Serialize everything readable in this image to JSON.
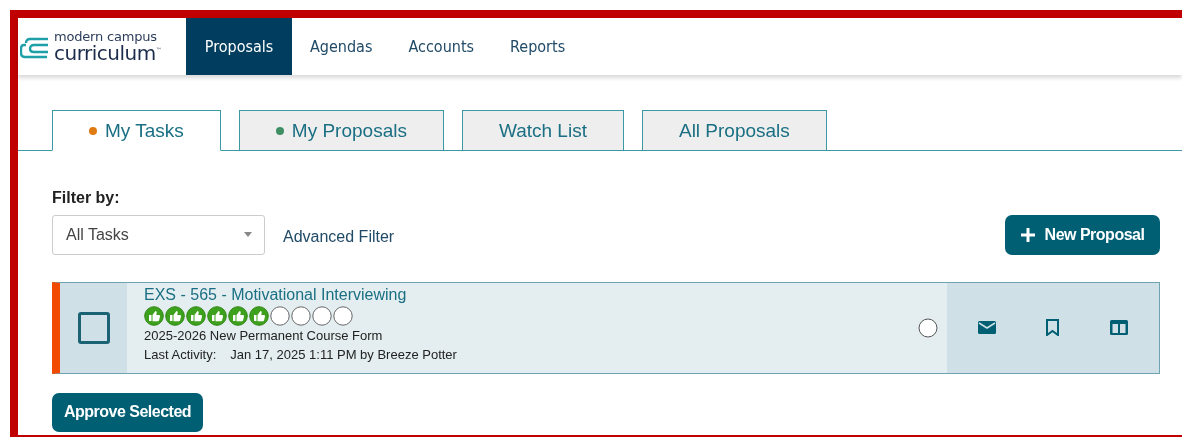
{
  "logo": {
    "line_1": "modern campus",
    "line_2": "curriculum$^{™}$"
  },
  "nav": [
    {
      "label": "Proposals",
      "selected": true
    },
    {
      "label": "Agendas",
      "selected": false
    },
    {
      "label": "Accounts",
      "selected": false
    },
    {
      "label": "Reports",
      "selected": false
    }
  ],
  "tabs": [
    {
      "label": "My Tasks",
      "selected": true,
      "color": "#e07b14"
    },
    {
      "label": "My Proposals",
      "selected": false,
      "color": "#3f8f64"
    },
    {
      "label": "Watch List",
      "selected": false
    },
    {
      "label": "All Proposals",
      "selected": false
    }
  ],
  "filter": {
    "label": "Filter by:",
    "value": "All Tasks",
    "advanced": "Advanced Filter"
  },
  "new_button": "New Proposal",
  "proposals": [
    {
      "title": "EXS - 565 - Motivational Interviewing",
      "checked": false,
      "steps": [
        {
          "done": true
        },
        {
          "done": true
        },
        {
          "done": true
        },
        {
          "done": true
        },
        {
          "done": true
        },
        {
          "done": true
        },
        {
          "done": false
        },
        {
          "done": false
        },
        {
          "done": false
        },
        {
          "done": false
        }
      ],
      "form": "2025-2026 New Permanent Course Form",
      "activity_label": "Last Activity:",
      "activity": "Jan 17, 2025 1:11 PM by Breeze Potter"
    }
  ],
  "approve_button": "Approve Selected"
}
